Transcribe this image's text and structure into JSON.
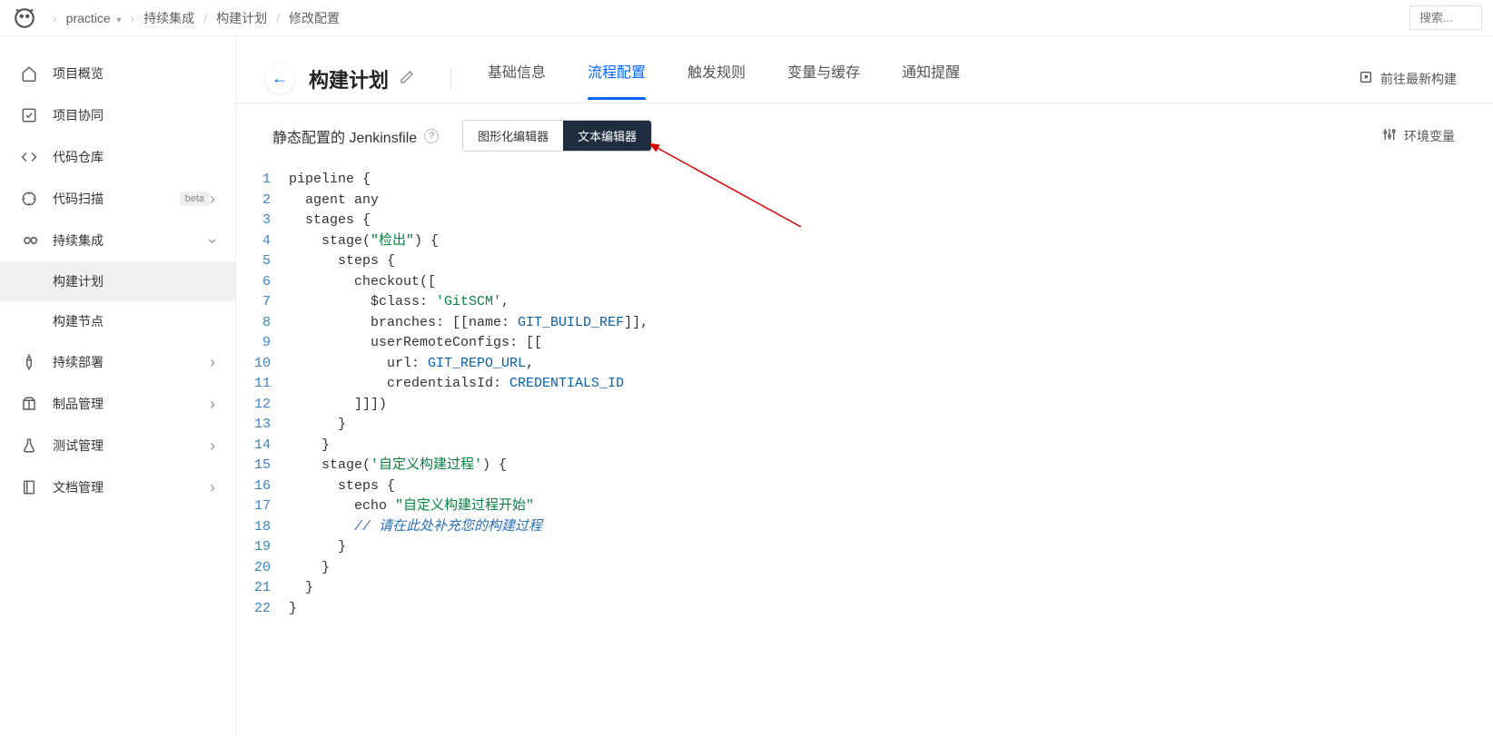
{
  "topbar": {
    "project_dropdown": "practice",
    "breadcrumb": [
      "持续集成",
      "构建计划",
      "修改配置"
    ],
    "search_placeholder": "搜索..."
  },
  "sidebar": {
    "items": [
      {
        "icon": "home",
        "label": "项目概览"
      },
      {
        "icon": "check-square",
        "label": "项目协同"
      },
      {
        "icon": "code",
        "label": "代码仓库"
      },
      {
        "icon": "scan",
        "label": "代码扫描",
        "badge": "beta",
        "expandable": true
      },
      {
        "icon": "infinity",
        "label": "持续集成",
        "expandable": true,
        "expanded": true,
        "children": [
          {
            "label": "构建计划",
            "active": true
          },
          {
            "label": "构建节点"
          }
        ]
      },
      {
        "icon": "rocket",
        "label": "持续部署",
        "expandable": true
      },
      {
        "icon": "package",
        "label": "制品管理",
        "expandable": true
      },
      {
        "icon": "flask",
        "label": "测试管理",
        "expandable": true
      },
      {
        "icon": "book",
        "label": "文档管理",
        "expandable": true
      }
    ]
  },
  "header": {
    "title": "构建计划",
    "tabs": [
      "基础信息",
      "流程配置",
      "触发规则",
      "变量与缓存",
      "通知提醒"
    ],
    "active_tab": 1,
    "goto_latest": "前往最新构建"
  },
  "subheader": {
    "title": "静态配置的 Jenkinsfile",
    "visual_editor": "图形化编辑器",
    "text_editor": "文本编辑器",
    "env_vars": "环境变量"
  },
  "code": {
    "lines": [
      {
        "n": 1,
        "segs": [
          {
            "t": "pipeline {"
          }
        ]
      },
      {
        "n": 2,
        "segs": [
          {
            "t": "  agent any"
          }
        ]
      },
      {
        "n": 3,
        "segs": [
          {
            "t": "  stages {"
          }
        ]
      },
      {
        "n": 4,
        "segs": [
          {
            "t": "    stage("
          },
          {
            "t": "\"检出\"",
            "c": "str"
          },
          {
            "t": ") {"
          }
        ]
      },
      {
        "n": 5,
        "segs": [
          {
            "t": "      steps {"
          }
        ]
      },
      {
        "n": 6,
        "segs": [
          {
            "t": "        checkout(["
          }
        ]
      },
      {
        "n": 7,
        "segs": [
          {
            "t": "          $class: "
          },
          {
            "t": "'GitSCM'",
            "c": "str"
          },
          {
            "t": ","
          }
        ]
      },
      {
        "n": 8,
        "segs": [
          {
            "t": "          branches: [[name: "
          },
          {
            "t": "GIT_BUILD_REF",
            "c": "var"
          },
          {
            "t": "]],"
          }
        ]
      },
      {
        "n": 9,
        "segs": [
          {
            "t": "          userRemoteConfigs: [["
          }
        ]
      },
      {
        "n": 10,
        "segs": [
          {
            "t": "            url: "
          },
          {
            "t": "GIT_REPO_URL",
            "c": "var"
          },
          {
            "t": ","
          }
        ]
      },
      {
        "n": 11,
        "segs": [
          {
            "t": "            credentialsId: "
          },
          {
            "t": "CREDENTIALS_ID",
            "c": "var"
          }
        ]
      },
      {
        "n": 12,
        "segs": [
          {
            "t": "        ]]])"
          }
        ]
      },
      {
        "n": 13,
        "segs": [
          {
            "t": "      }"
          }
        ]
      },
      {
        "n": 14,
        "segs": [
          {
            "t": "    }"
          }
        ]
      },
      {
        "n": 15,
        "segs": [
          {
            "t": "    stage("
          },
          {
            "t": "'自定义构建过程'",
            "c": "str"
          },
          {
            "t": ") {"
          }
        ]
      },
      {
        "n": 16,
        "segs": [
          {
            "t": "      steps {"
          }
        ]
      },
      {
        "n": 17,
        "segs": [
          {
            "t": "        echo "
          },
          {
            "t": "\"自定义构建过程开始\"",
            "c": "str"
          }
        ]
      },
      {
        "n": 18,
        "segs": [
          {
            "t": "        "
          },
          {
            "t": "// 请在此处补充您的构建过程",
            "c": "cmt"
          }
        ]
      },
      {
        "n": 19,
        "segs": [
          {
            "t": "      }"
          }
        ]
      },
      {
        "n": 20,
        "segs": [
          {
            "t": "    }"
          }
        ]
      },
      {
        "n": 21,
        "segs": [
          {
            "t": "  }"
          }
        ]
      },
      {
        "n": 22,
        "segs": [
          {
            "t": "}"
          }
        ]
      }
    ]
  }
}
